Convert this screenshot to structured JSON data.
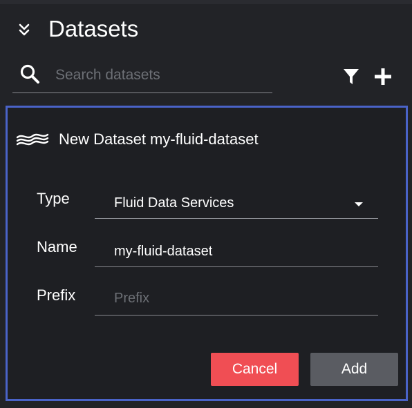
{
  "header": {
    "title": "Datasets",
    "collapse_icon": "double-chevron-down-icon"
  },
  "search": {
    "placeholder": "Search datasets",
    "value": "",
    "icon": "search-icon"
  },
  "toolbar": {
    "filter_icon": "filter-icon",
    "add_icon": "plus-icon"
  },
  "new_dataset_card": {
    "icon": "fluid-waves-icon",
    "title": "New Dataset my-fluid-dataset",
    "accent_color": "#4a63c8",
    "fields": {
      "type": {
        "label": "Type",
        "selected": "Fluid Data Services"
      },
      "name": {
        "label": "Name",
        "value": "my-fluid-dataset"
      },
      "prefix": {
        "label": "Prefix",
        "value": "",
        "placeholder": "Prefix"
      }
    },
    "buttons": {
      "cancel_label": "Cancel",
      "cancel_color": "#f04e54",
      "add_label": "Add",
      "add_color": "#5a5c62"
    }
  }
}
